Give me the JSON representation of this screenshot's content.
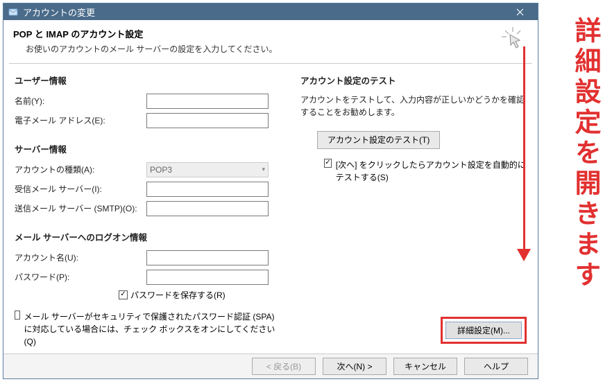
{
  "window": {
    "title": "アカウントの変更"
  },
  "header": {
    "title": "POP と IMAP のアカウント設定",
    "subtitle": "お使いのアカウントのメール サーバーの設定を入力してください。"
  },
  "left": {
    "user_section": "ユーザー情報",
    "name_label": "名前(Y):",
    "email_label": "電子メール アドレス(E):",
    "server_section": "サーバー情報",
    "account_type_label": "アカウントの種類(A):",
    "account_type_value": "POP3",
    "incoming_label": "受信メール サーバー(I):",
    "outgoing_label": "送信メール サーバー (SMTP)(O):",
    "logon_section": "メール サーバーへのログオン情報",
    "account_name_label": "アカウント名(U):",
    "password_label": "パスワード(P):",
    "save_password_label": "パスワードを保存する(R)",
    "spa_label": "メール サーバーがセキュリティで保護されたパスワード認証 (SPA) に対応している場合には、チェック ボックスをオンにしてください(Q)",
    "name_value": "",
    "email_value": "",
    "incoming_value": "",
    "outgoing_value": "",
    "account_name_value": "",
    "password_value": ""
  },
  "right": {
    "test_section": "アカウント設定のテスト",
    "test_text": "アカウントをテストして、入力内容が正しいかどうかを確認することをお勧めします。",
    "test_button": "アカウント設定のテスト(T)",
    "auto_test_label": "[次へ] をクリックしたらアカウント設定を自動的にテストする(S)",
    "advanced_button": "詳細設定(M)..."
  },
  "buttons": {
    "back": "< 戻る(B)",
    "next": "次へ(N) >",
    "cancel": "キャンセル",
    "help": "ヘルプ"
  },
  "annotation": {
    "text": "詳細設定を開きます"
  }
}
